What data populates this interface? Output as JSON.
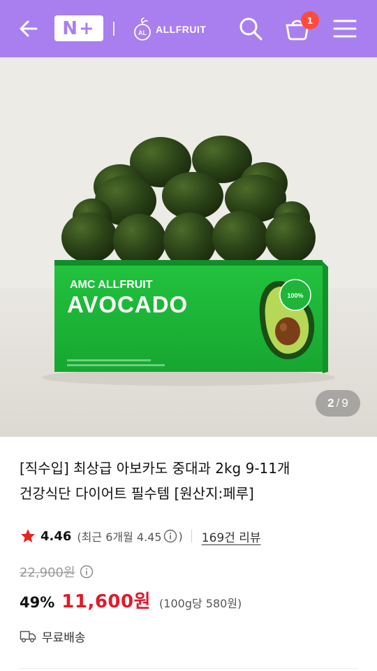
{
  "header": {
    "nplus_label": "N+",
    "brand_name": "ALLFRUIT",
    "brand_logo_text": "AL",
    "cart_count": "1",
    "icons": [
      "back-arrow-icon",
      "search-icon",
      "cart-icon",
      "menu-icon"
    ]
  },
  "gallery": {
    "current": "2",
    "separator": "/",
    "total": "9",
    "box_brand": "AMC ALLFRUIT",
    "box_product": "AVOCADO",
    "box_badge": "100%"
  },
  "product": {
    "title_line1": "[직수입] 최상급 아보카도 중대과 2kg 9-11개",
    "title_line2": "건강식단 다이어트 필수템 [원산지:페루]",
    "rating": "4.46",
    "recent_rating_prefix": "(최근 6개월 4.45",
    "recent_rating_suffix": ")",
    "review_count": "169건 리뷰",
    "original_price": "22,900원",
    "discount_rate": "49%",
    "sale_price": "11,600원",
    "unit_price": "(100g당 580원)",
    "shipping": "무료배송"
  },
  "colors": {
    "header_bg": "#a97ff0",
    "sale_red": "#e1192b",
    "star": "#e8231d",
    "badge": "#ff4b3e",
    "box_green": "#1eb53a"
  }
}
